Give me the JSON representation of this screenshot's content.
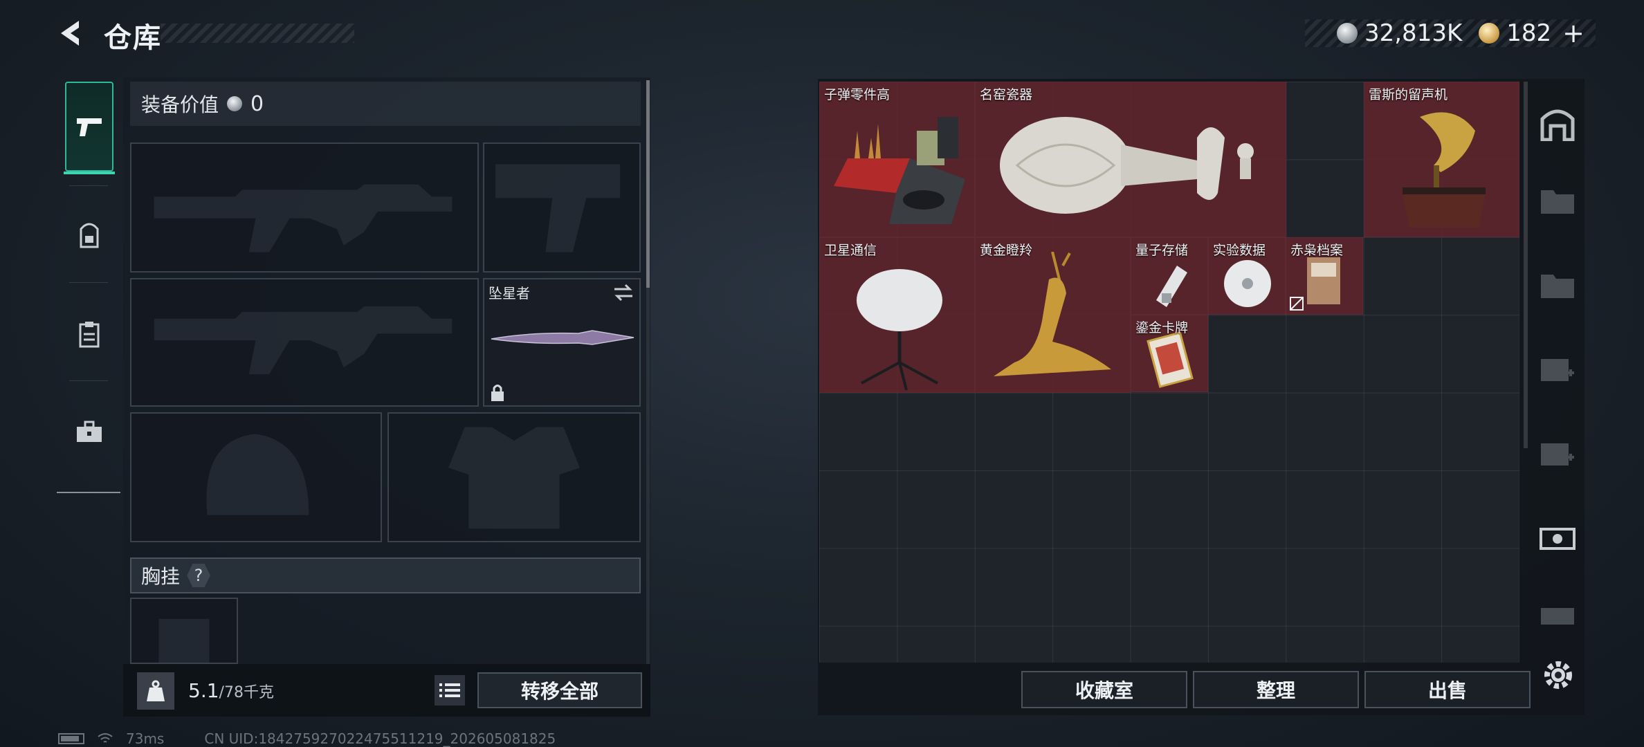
{
  "header": {
    "title": "仓库",
    "currency_silver": "32,813K",
    "currency_gold": "182",
    "plus_label": "+"
  },
  "left_tabs": [
    {
      "id": "weapons",
      "icon": "pistol-icon",
      "active": true
    },
    {
      "id": "backpack",
      "icon": "backpack-icon",
      "active": false
    },
    {
      "id": "clipboard",
      "icon": "clipboard-icon",
      "active": false
    },
    {
      "id": "case",
      "icon": "briefcase-icon",
      "active": false
    }
  ],
  "equipment": {
    "value_label": "装备价值",
    "value": "0",
    "melee_name": "坠星者",
    "chest_label": "胸挂",
    "chest_help": "?",
    "weight_current": "5.1",
    "weight_max": "/78千克",
    "transfer_all": "转移全部"
  },
  "storage_items": [
    {
      "name": "子弹零件高",
      "icon": "ammo-crate-icon"
    },
    {
      "name": "名窑瓷器",
      "icon": "porcelain-vase-icon"
    },
    {
      "name": "雷斯的留声机",
      "icon": "gramophone-icon"
    },
    {
      "name": "卫星通信",
      "icon": "satellite-dish-icon"
    },
    {
      "name": "黄金瞪羚",
      "icon": "golden-gazelle-icon"
    },
    {
      "name": "量子存储",
      "icon": "usb-drive-icon"
    },
    {
      "name": "实验数据",
      "icon": "disc-icon"
    },
    {
      "name": "赤枭档案",
      "icon": "file-icon"
    },
    {
      "name": "鎏金卡牌",
      "icon": "card-icon"
    }
  ],
  "bottom_buttons": {
    "collection": "收藏室",
    "sort": "整理",
    "sell": "出售"
  },
  "status": {
    "ping": "73ms",
    "uid": "CN UID:184275927022475511219_202605081825"
  },
  "colors": {
    "accent": "#2fb99a",
    "item_bg": "#60242a"
  }
}
